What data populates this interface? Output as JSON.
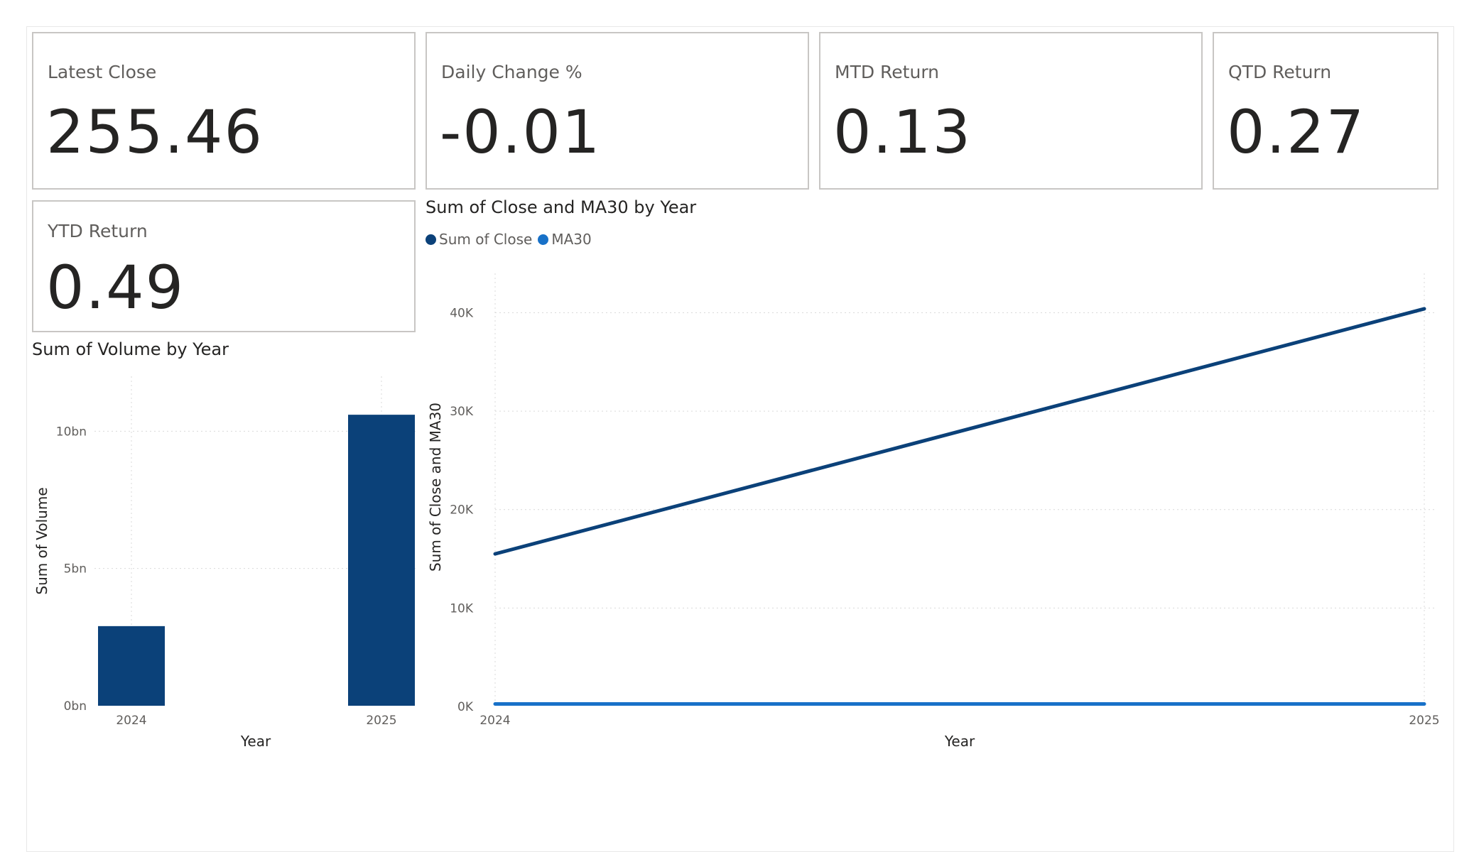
{
  "kpis": {
    "latest_close": {
      "label": "Latest Close",
      "value": "255.46"
    },
    "daily_change": {
      "label": "Daily Change %",
      "value": "-0.01"
    },
    "mtd_return": {
      "label": "MTD Return",
      "value": "0.13"
    },
    "qtd_return": {
      "label": "QTD Return",
      "value": "0.27"
    },
    "ytd_return": {
      "label": "YTD Return",
      "value": "0.49"
    }
  },
  "colors": {
    "close": "#0b4179",
    "ma30": "#1871c8",
    "bar": "#0b4179",
    "grid": "#d9d9d9",
    "card_border": "#c8c6c4"
  },
  "chart_data": [
    {
      "type": "bar",
      "title": "Sum of Volume by Year",
      "categories": [
        "2024",
        "2025"
      ],
      "values": [
        2900000000,
        10600000000
      ],
      "xlabel": "Year",
      "ylabel": "Sum of Volume",
      "ylim": [
        0,
        12000000000
      ],
      "yticks": [
        {
          "value": 0,
          "label": "0bn"
        },
        {
          "value": 5000000000,
          "label": "5bn"
        },
        {
          "value": 10000000000,
          "label": "10bn"
        }
      ],
      "grid": true,
      "color": "#0b4179"
    },
    {
      "type": "line",
      "title": "Sum of Close and MA30 by Year",
      "x": [
        "2024",
        "2025"
      ],
      "series": [
        {
          "name": "Sum of Close",
          "values": [
            15500,
            40400
          ],
          "color": "#0b4179"
        },
        {
          "name": "MA30",
          "values": [
            250,
            250
          ],
          "color": "#1871c8"
        }
      ],
      "xlabel": "Year",
      "ylabel": "Sum of Close and MA30",
      "ylim": [
        0,
        44000
      ],
      "yticks": [
        {
          "value": 0,
          "label": "0K"
        },
        {
          "value": 10000,
          "label": "10K"
        },
        {
          "value": 20000,
          "label": "20K"
        },
        {
          "value": 30000,
          "label": "30K"
        },
        {
          "value": 40000,
          "label": "40K"
        }
      ],
      "legend": "top-left",
      "grid": true
    }
  ]
}
